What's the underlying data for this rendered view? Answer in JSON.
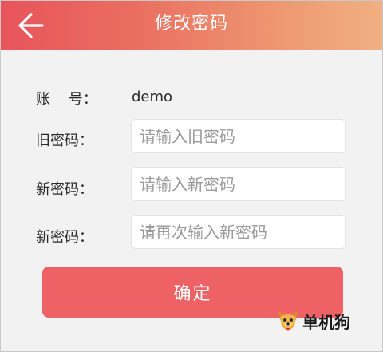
{
  "header": {
    "back_icon": "arrow-left-icon",
    "title": "修改密码"
  },
  "form": {
    "account_label": "账    号：",
    "account_value": "demo",
    "old_password_label": "旧密码：",
    "old_password_placeholder": "请输入旧密码",
    "new_password_label": "新密码：",
    "new_password_placeholder": "请输入新密码",
    "confirm_password_label": "新密码：",
    "confirm_password_placeholder": "请再次输入新密码"
  },
  "actions": {
    "confirm_label": "确定"
  },
  "watermark": {
    "icon": "dog-mascot-icon",
    "text": "单机狗"
  },
  "colors": {
    "header_gradient_start": "#e8545b",
    "header_gradient_end": "#f1b083",
    "confirm_button": "#ee6266",
    "page_background": "#f2f2f2"
  }
}
